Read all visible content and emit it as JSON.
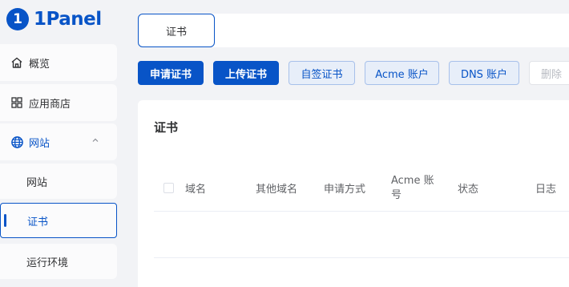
{
  "app": {
    "logo_mark": "1",
    "logo_text": "1Panel"
  },
  "sidebar": {
    "items": [
      {
        "label": "概览",
        "icon": "home-icon"
      },
      {
        "label": "应用商店",
        "icon": "grid-icon"
      },
      {
        "label": "网站",
        "icon": "globe-icon",
        "expanded": true
      },
      {
        "label": "网站",
        "sub": true
      },
      {
        "label": "证书",
        "sub": true,
        "selected": true
      },
      {
        "label": "运行环境",
        "sub": true
      }
    ]
  },
  "tabs": [
    {
      "label": "证书"
    }
  ],
  "toolbar": {
    "apply": "申请证书",
    "upload": "上传证书",
    "self_signed": "自签证书",
    "acme": "Acme 账户",
    "dns": "DNS 账户",
    "delete": "删除"
  },
  "card": {
    "title": "证书",
    "columns": [
      "域名",
      "其他域名",
      "申请方式",
      "Acme 账号",
      "状态",
      "日志"
    ]
  },
  "colors": {
    "primary": "#0854c7",
    "background": "#f2f3f6"
  }
}
